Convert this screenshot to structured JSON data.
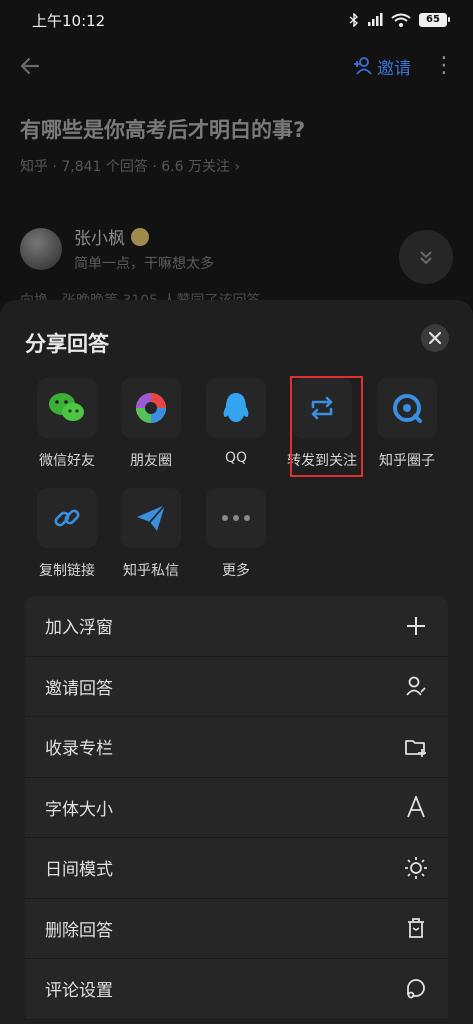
{
  "status_bar": {
    "time": "上午10:12",
    "battery": "65"
  },
  "topbar": {
    "invite_label": "邀请",
    "more_glyph": "⋮"
  },
  "question": {
    "title": "有哪些是你高考后才明白的事?",
    "meta": "知乎 · 7,841 个回答 · 6.6 万关注 ›"
  },
  "author": {
    "name": "张小枫",
    "bio": "简单一点，干嘛想太多",
    "underlying_text": "向换、张晚晚等 3105 人赞同了该回答"
  },
  "share_sheet": {
    "title": "分享回答",
    "items": [
      {
        "label": "微信好友",
        "icon": "wechat-icon"
      },
      {
        "label": "朋友圈",
        "icon": "moments-icon"
      },
      {
        "label": "QQ",
        "icon": "qq-icon"
      },
      {
        "label": "转发到关注",
        "icon": "repost-icon"
      },
      {
        "label": "知乎圈子",
        "icon": "circle-icon"
      },
      {
        "label": "复制链接",
        "icon": "link-icon"
      },
      {
        "label": "知乎私信",
        "icon": "send-icon"
      },
      {
        "label": "更多",
        "icon": "more-icon"
      }
    ]
  },
  "menu": [
    {
      "label": "加入浮窗",
      "icon": "plus-icon"
    },
    {
      "label": "邀请回答",
      "icon": "invite-user-icon"
    },
    {
      "label": "收录专栏",
      "icon": "folder-add-icon"
    },
    {
      "label": "字体大小",
      "icon": "font-icon"
    },
    {
      "label": "日间模式",
      "icon": "sun-icon"
    },
    {
      "label": "删除回答",
      "icon": "delete-icon"
    },
    {
      "label": "评论设置",
      "icon": "comment-settings-icon"
    }
  ],
  "colors": {
    "accent": "#3a6fd6",
    "highlight": "#e03030",
    "sheet": "#1f1f1f"
  }
}
